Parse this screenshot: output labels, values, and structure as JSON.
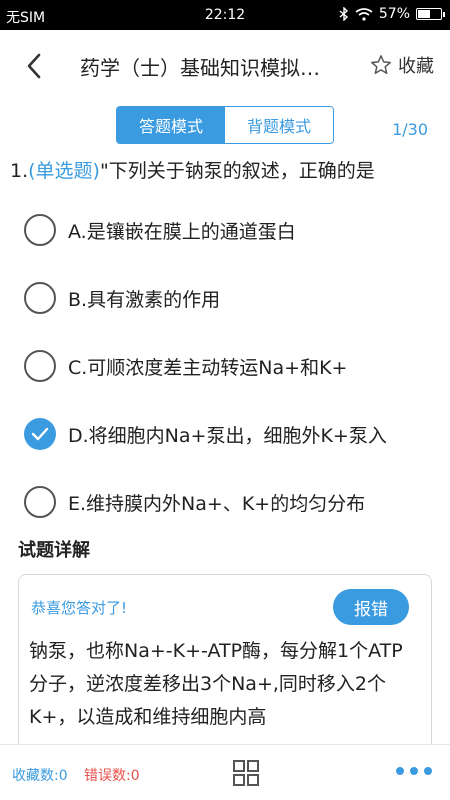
{
  "status_bar": {
    "carrier": "无SIM",
    "time": "22:12",
    "battery": "57%",
    "battery_level": 0.57
  },
  "header": {
    "title": "药学（士）基础知识模拟…",
    "favorite_label": "收藏"
  },
  "modes": {
    "answer_mode": "答题模式",
    "review_mode": "背题模式"
  },
  "progress": "1/30",
  "question": {
    "number": "1.",
    "type": "(单选题)",
    "text": "\"下列关于钠泵的叙述，正确的是"
  },
  "options": [
    {
      "label": "A.是镶嵌在膜上的通道蛋白",
      "checked": false
    },
    {
      "label": "B.具有激素的作用",
      "checked": false
    },
    {
      "label": "C.可顺浓度差主动转运Na+和K+",
      "checked": false
    },
    {
      "label": "D.将细胞内Na+泵出，细胞外K+泵入",
      "checked": true
    },
    {
      "label": "E.维持膜内外Na+、K+的均匀分布",
      "checked": false
    }
  ],
  "detail": {
    "heading": "试题详解",
    "congrats": "恭喜您答对了!",
    "report_label": "报错",
    "body": "钠泵，也称Na+-K+-ATP酶，每分解1个ATP分子，逆浓度差移出3个Na+,同时移入2个K+，以造成和维持细胞内高"
  },
  "bottom": {
    "favorites": "收藏数:0",
    "errors": "错误数:0"
  },
  "colors": {
    "accent": "#3a9be0",
    "error": "#e8504a"
  },
  "icons": {
    "back": "chevron-left-icon",
    "favorite": "star-outline-icon",
    "grid": "grid-icon",
    "more": "more-dots-icon",
    "check": "check-icon",
    "bluetooth": "bluetooth-icon",
    "wifi": "wifi-icon"
  }
}
